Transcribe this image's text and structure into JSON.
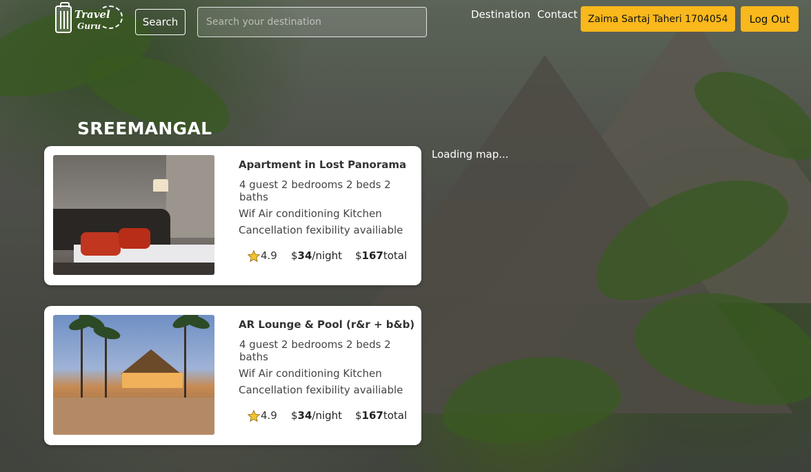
{
  "header": {
    "logo_text_1": "Travel",
    "logo_text_2": "Guru",
    "search_button": "Search",
    "search_placeholder": "Search your destination",
    "nav_destination": "Destination",
    "nav_contact": "Contact",
    "user_button": "Zaima Sartaj Taheri 1704054",
    "logout_button": "Log Out",
    "accent_color": "#f9b81b"
  },
  "page": {
    "title": "SREEMANGAL",
    "map_status": "Loading map..."
  },
  "listings": [
    {
      "title": "Apartment in Lost Panorama",
      "features": "4 guest 2 bedrooms 2 beds 2 baths",
      "amenities": "Wif Air conditioning Kitchen Cancellation fexibility availiable",
      "rating": "4.9",
      "price_per_night": "34",
      "per_night_label": "/night",
      "total_price": "167",
      "total_label": "total",
      "currency": "$",
      "image": "bedroom-photo"
    },
    {
      "title": "AR Lounge & Pool (r&r + b&b)",
      "features": "4 guest 2 bedrooms 2 beds 2 baths",
      "amenities": "Wif Air conditioning Kitchen Cancellation fexibility availiable",
      "rating": "4.9",
      "price_per_night": "34",
      "per_night_label": "/night",
      "total_price": "167",
      "total_label": "total",
      "currency": "$",
      "image": "beach-lounge-photo"
    }
  ],
  "icons": {
    "star": "star-icon",
    "logo": "luggage-icon"
  }
}
